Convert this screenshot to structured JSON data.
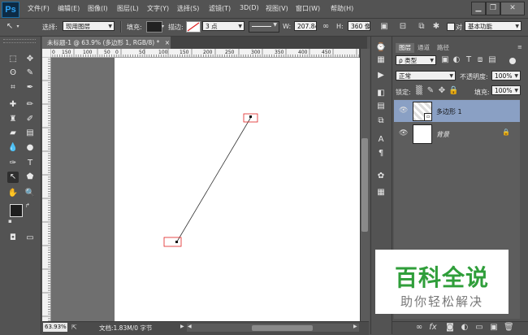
{
  "app": {
    "logo": "Ps"
  },
  "menu": [
    "文件(F)",
    "编辑(E)",
    "图像(I)",
    "图层(L)",
    "文字(Y)",
    "选择(S)",
    "滤镜(T)",
    "3D(D)",
    "视图(V)",
    "窗口(W)",
    "帮助(H)"
  ],
  "window_controls": {
    "minimize": "▁",
    "restore": "❐",
    "close": "✕"
  },
  "options": {
    "select_label": "选择:",
    "select_value": "现用图层",
    "fill_label": "填充:",
    "stroke_label": "描边:",
    "stroke_width": "3 点",
    "w_label": "W:",
    "w_value": "207.84",
    "h_label": "H:",
    "h_value": "360 像",
    "align_label": "对",
    "workspace": "基本功能"
  },
  "document": {
    "tab_title": "未标题-1 @ 63.9% (多边形 1, RGB/8) *",
    "close": "×",
    "zoom": "63.93%",
    "info": "文档:1.83M/0 字节"
  },
  "ruler": {
    "top_labels": [
      "0",
      "150",
      "100",
      "50",
      "0",
      "50",
      "100",
      "150",
      "200",
      "250",
      "300",
      "350",
      "400",
      "450"
    ]
  },
  "layers_panel": {
    "tabs": [
      "图层",
      "通道",
      "路径"
    ],
    "filter_label": "ρ 类型",
    "blend_mode": "正常",
    "opacity_label": "不透明度:",
    "opacity_value": "100%",
    "lock_label": "锁定:",
    "fill_label": "填充:",
    "fill_value": "100%",
    "layers": [
      {
        "name": "多边形 1",
        "selected": true
      },
      {
        "name": "背景",
        "locked": true
      }
    ],
    "footer_icons": [
      "link-icon",
      "fx-icon",
      "mask-icon",
      "adjustment-icon",
      "group-icon",
      "new-layer-icon",
      "trash-icon"
    ]
  },
  "watermark": {
    "title": "百科全说",
    "subtitle": "助你轻松解决"
  },
  "colors": {
    "accent": "#8aa0c4",
    "selection_box": "#e02020"
  }
}
